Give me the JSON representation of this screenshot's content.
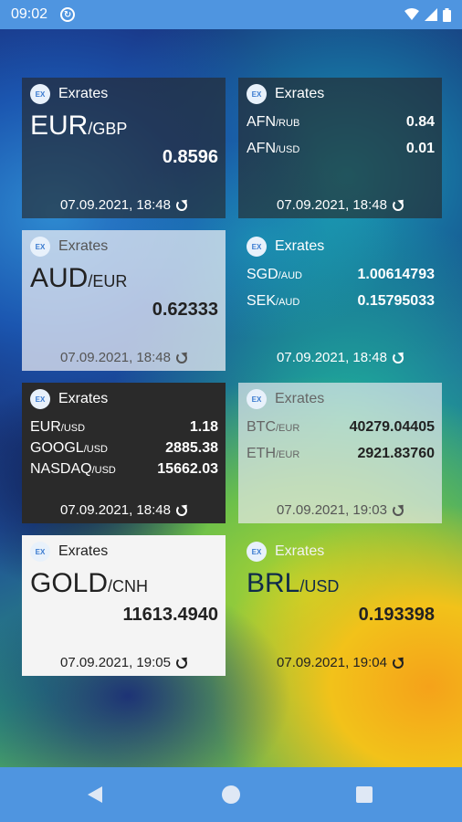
{
  "status_bar": {
    "time": "09:02"
  },
  "widgets": [
    {
      "app": "Exrates",
      "base": "EUR",
      "quote": "/GBP",
      "value": "0.8596",
      "updated": "07.09.2021, 18:48"
    },
    {
      "app": "Exrates",
      "rows": [
        {
          "base": "AFN",
          "quote": "/RUB",
          "value": "0.84"
        },
        {
          "base": "AFN",
          "quote": "/USD",
          "value": "0.01"
        }
      ],
      "updated": "07.09.2021, 18:48"
    },
    {
      "app": "Exrates",
      "base": "AUD",
      "quote": "/EUR",
      "value": "0.62333",
      "updated": "07.09.2021, 18:48"
    },
    {
      "app": "Exrates",
      "rows": [
        {
          "base": "SGD",
          "quote": "/AUD",
          "value": "1.00614793"
        },
        {
          "base": "SEK",
          "quote": "/AUD",
          "value": "0.15795033"
        }
      ],
      "updated": "07.09.2021, 18:48"
    },
    {
      "app": "Exrates",
      "rows": [
        {
          "base": "EUR",
          "quote": "/USD",
          "value": "1.18"
        },
        {
          "base": "GOOGL",
          "quote": "/USD",
          "value": "2885.38"
        },
        {
          "base": "NASDAQ",
          "quote": "/USD",
          "value": "15662.03"
        }
      ],
      "updated": "07.09.2021, 18:48"
    },
    {
      "app": "Exrates",
      "rows": [
        {
          "base": "BTC",
          "quote": "/EUR",
          "value": "40279.04405"
        },
        {
          "base": "ETH",
          "quote": "/EUR",
          "value": "2921.83760"
        }
      ],
      "updated": "07.09.2021, 19:03"
    },
    {
      "app": "Exrates",
      "base": "GOLD",
      "quote": "/CNH",
      "value": "11613.4940",
      "updated": "07.09.2021, 19:05"
    },
    {
      "app": "Exrates",
      "base": "BRL",
      "quote": "/USD",
      "value": "0.193398",
      "updated": "07.09.2021, 19:04"
    }
  ],
  "logo_text": "EX"
}
